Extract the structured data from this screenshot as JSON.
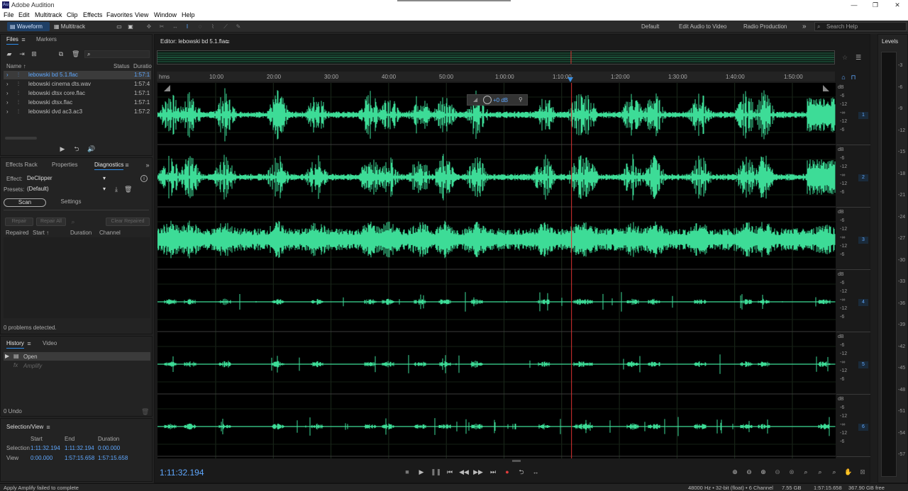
{
  "title_bar": {
    "app_title": "Adobe Audition",
    "icon_text": "Au",
    "minimize": "—",
    "maximize": "❐",
    "close": "✕"
  },
  "menu": [
    "File",
    "Edit",
    "Multitrack",
    "Clip",
    "Effects",
    "Favorites",
    "View",
    "Window",
    "Help"
  ],
  "toolbar": {
    "waveform": "Waveform",
    "multitrack": "Multitrack",
    "workspaces": [
      "Default",
      "Edit Audio to Video",
      "Radio Production"
    ],
    "more": "»",
    "search_placeholder": "Search Help"
  },
  "files_panel": {
    "tabs": [
      "Files",
      "Markers"
    ],
    "columns": {
      "name": "Name",
      "status": "Status",
      "duration": "Duratio"
    },
    "files": [
      {
        "name": "lebowski bd 5.1.flac",
        "duration": "1:57:1",
        "selected": true
      },
      {
        "name": "lebowski cinema dts.wav",
        "duration": "1:57:4"
      },
      {
        "name": "lebowski dtsx core.flac",
        "duration": "1:57:1"
      },
      {
        "name": "lebowski dtsx.flac",
        "duration": "1:57:1"
      },
      {
        "name": "lebowski dvd ac3.ac3",
        "duration": "1:57:2"
      }
    ]
  },
  "diagnostics_panel": {
    "tabs": [
      "Effects Rack",
      "Properties",
      "Diagnostics"
    ],
    "effect_label": "Effect:",
    "effect_value": "DeClipper",
    "presets_label": "Presets:",
    "presets_value": "(Default)",
    "scan_tab": "Scan",
    "settings_tab": "Settings",
    "buttons": [
      "Repair",
      "Repair All",
      "Clear Repaired"
    ],
    "columns": [
      "Repaired",
      "Start",
      "Duration",
      "Channel"
    ],
    "status": "0 problems detected."
  },
  "history_panel": {
    "tabs": [
      "History",
      "Video"
    ],
    "items": [
      "Open",
      "Amplify"
    ],
    "undo": "0 Undo"
  },
  "selection_view": {
    "title": "Selection/View",
    "headers": [
      "Start",
      "End",
      "Duration"
    ],
    "selection_label": "Selection",
    "selection": [
      "1:11:32.194",
      "1:11:32.194",
      "0:00.000"
    ],
    "view_label": "View",
    "view": [
      "0:00.000",
      "1:57:15.658",
      "1:57:15.658"
    ]
  },
  "editor": {
    "tab_title": "Editor: lebowski bd 5.1.flac",
    "ruler_unit": "hms",
    "ruler_ticks": [
      "10:00",
      "20:00",
      "30:00",
      "40:00",
      "50:00",
      "1:00:00",
      "1:10:00",
      "1:20:00",
      "1:30:00",
      "1:40:00",
      "1:50:00"
    ],
    "hud_gain": "+0 dB",
    "db_scale": [
      "dB",
      "-6",
      "-12",
      "-∞",
      "-12",
      "-6"
    ],
    "channels": [
      "1",
      "2",
      "3",
      "4",
      "5",
      "6"
    ],
    "current_time": "1:11:32.194",
    "playhead_fraction": 0.61,
    "waveform_color": "#3ddc97"
  },
  "levels": {
    "title": "Levels",
    "scale": [
      "-3",
      "-6",
      "-9",
      "-12",
      "-15",
      "-18",
      "-21",
      "-24",
      "-27",
      "-30",
      "-33",
      "-36",
      "-39",
      "-42",
      "-45",
      "-48",
      "-51",
      "-54",
      "-57"
    ]
  },
  "status_bar": {
    "message": "Apply Amplify failed to complete",
    "sample_rate": "48000 Hz • 32-bit (float) • 6 Channel",
    "file_size": "7.55 GB",
    "duration": "1:57:15.658",
    "free_space": "367.90 GB free"
  }
}
